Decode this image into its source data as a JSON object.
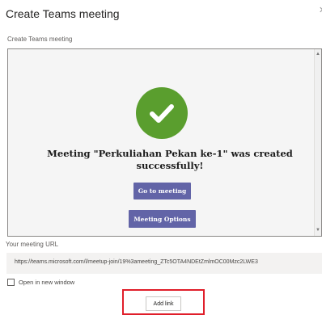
{
  "dialog": {
    "title": "Create Teams meeting",
    "subtitle": "Create Teams meeting"
  },
  "confirmation": {
    "message": "Meeting \"Perkuliahan Pekan ke-1\" was created successfully!",
    "go_to_meeting_label": "Go to meeting",
    "meeting_options_label": "Meeting Options",
    "check_color": "#5a9e2e",
    "button_color": "#6264a7"
  },
  "meeting_url": {
    "label": "Your meeting URL",
    "value": "https://teams.microsoft.com/l/meetup-join/19%3ameeting_ZTc5OTA4NDEtZmlmOC00Mzc2LWE3"
  },
  "open_in_new_window": {
    "label": "Open in new window",
    "checked": false
  },
  "add_link_label": "Add link",
  "highlight_color": "#e01e2a"
}
